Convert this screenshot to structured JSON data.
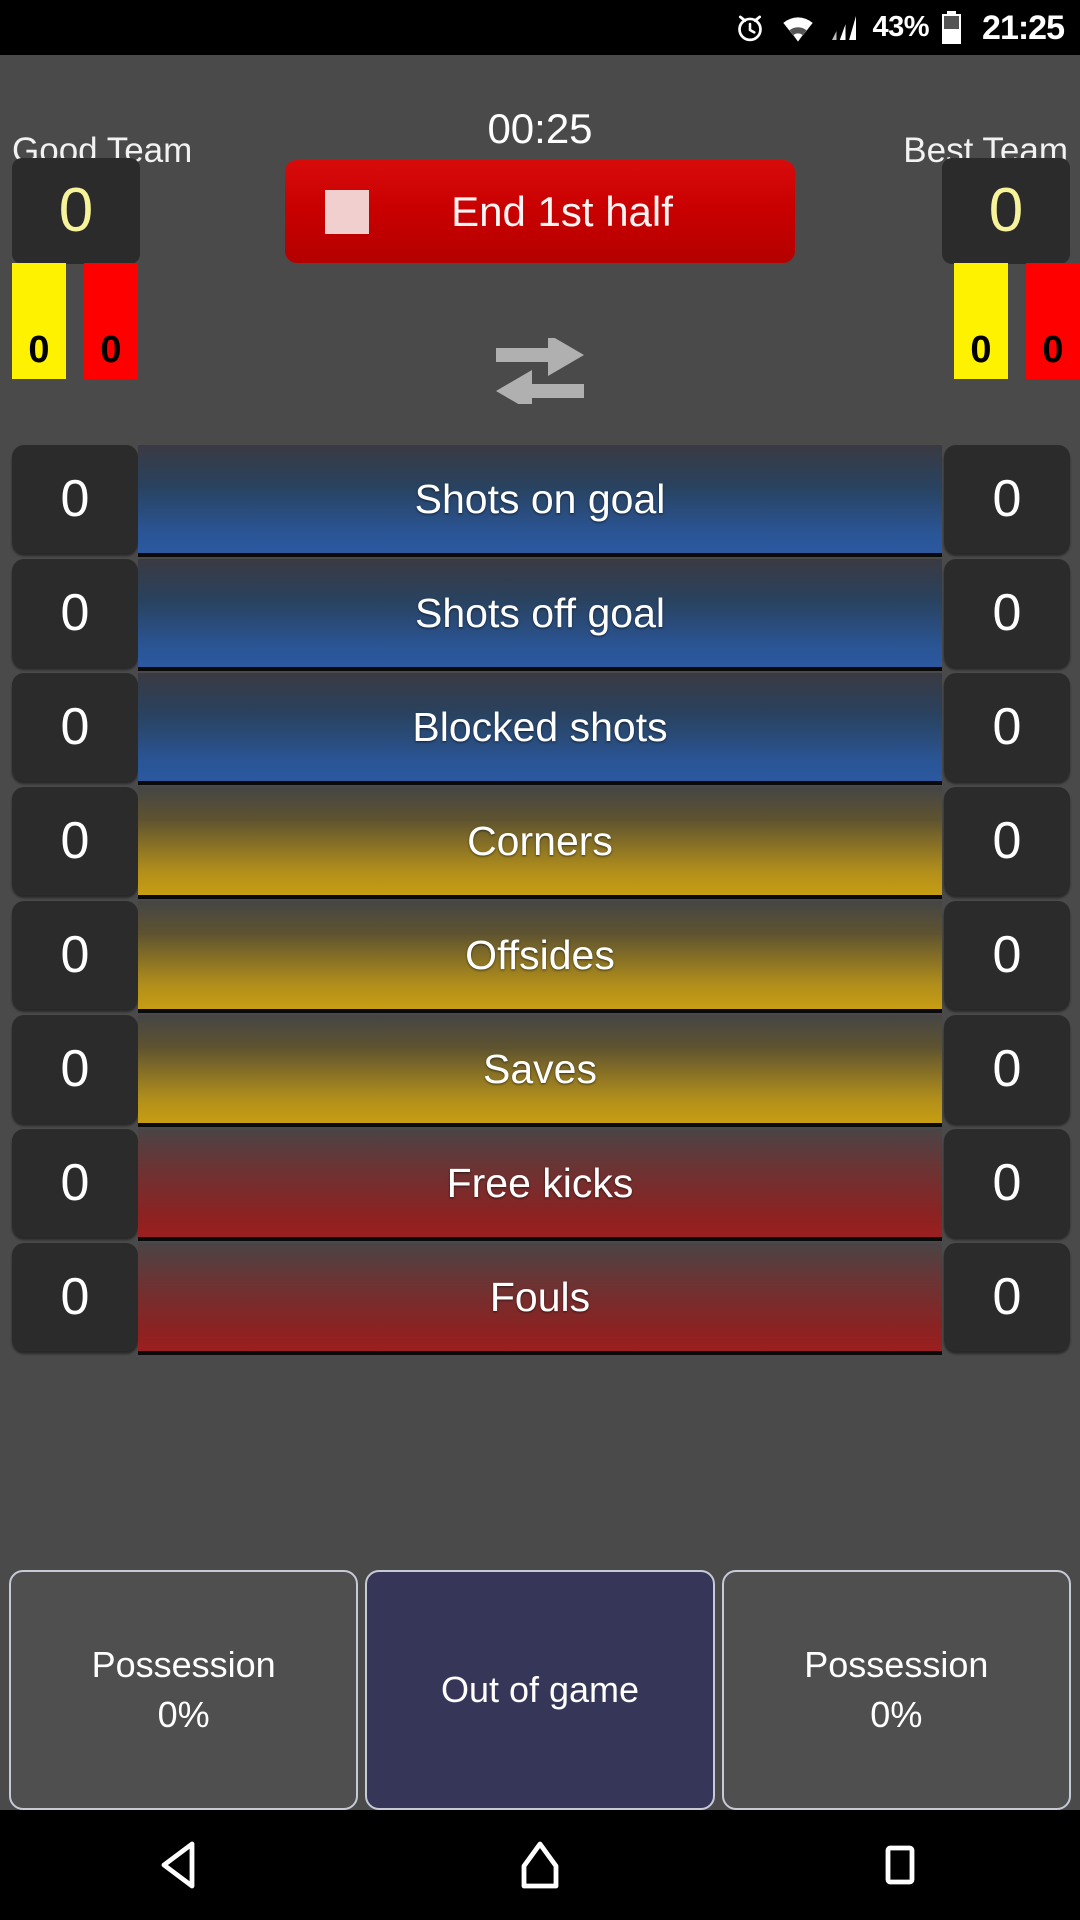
{
  "status_bar": {
    "alarm_icon": "alarm-clock-icon",
    "wifi_icon": "wifi-icon",
    "signal_icon": "cell-signal-icon",
    "battery_percent": "43%",
    "battery_icon": "battery-icon",
    "time": "21:25"
  },
  "scoreboard": {
    "home": {
      "name": "Good Team",
      "score": "0",
      "yellow_cards": "0",
      "red_cards": "0"
    },
    "away": {
      "name": "Best Team",
      "score": "0",
      "yellow_cards": "0",
      "red_cards": "0"
    },
    "timer": "00:25",
    "half_button_label": "End 1st half",
    "half_button_icon": "stop-square-icon",
    "half_button_color": "#c90000",
    "swap_icon": "swap-horizontal-icon",
    "score_color": "#f7f39a"
  },
  "stats": {
    "rows": [
      {
        "label": "Shots on goal",
        "home": "0",
        "away": "0",
        "color": "#2b58a0",
        "group": "blue"
      },
      {
        "label": "Shots off goal",
        "home": "0",
        "away": "0",
        "color": "#2b58a0",
        "group": "blue"
      },
      {
        "label": "Blocked shots",
        "home": "0",
        "away": "0",
        "color": "#2b58a0",
        "group": "blue"
      },
      {
        "label": "Corners",
        "home": "0",
        "away": "0",
        "color": "#c79d12",
        "group": "gold"
      },
      {
        "label": "Offsides",
        "home": "0",
        "away": "0",
        "color": "#c79d12",
        "group": "gold"
      },
      {
        "label": "Saves",
        "home": "0",
        "away": "0",
        "color": "#c79d12",
        "group": "gold"
      },
      {
        "label": "Free kicks",
        "home": "0",
        "away": "0",
        "color": "#9b1f1f",
        "group": "red"
      },
      {
        "label": "Fouls",
        "home": "0",
        "away": "0",
        "color": "#9b1f1f",
        "group": "red"
      }
    ]
  },
  "bottom_bar": {
    "home_possession": {
      "title": "Possession",
      "value": "0%"
    },
    "out_of_game": {
      "label": "Out of game",
      "color": "#363659"
    },
    "away_possession": {
      "title": "Possession",
      "value": "0%"
    }
  },
  "nav_bar": {
    "back_icon": "back-triangle-icon",
    "home_icon": "home-icon",
    "recents_icon": "recents-square-icon"
  }
}
